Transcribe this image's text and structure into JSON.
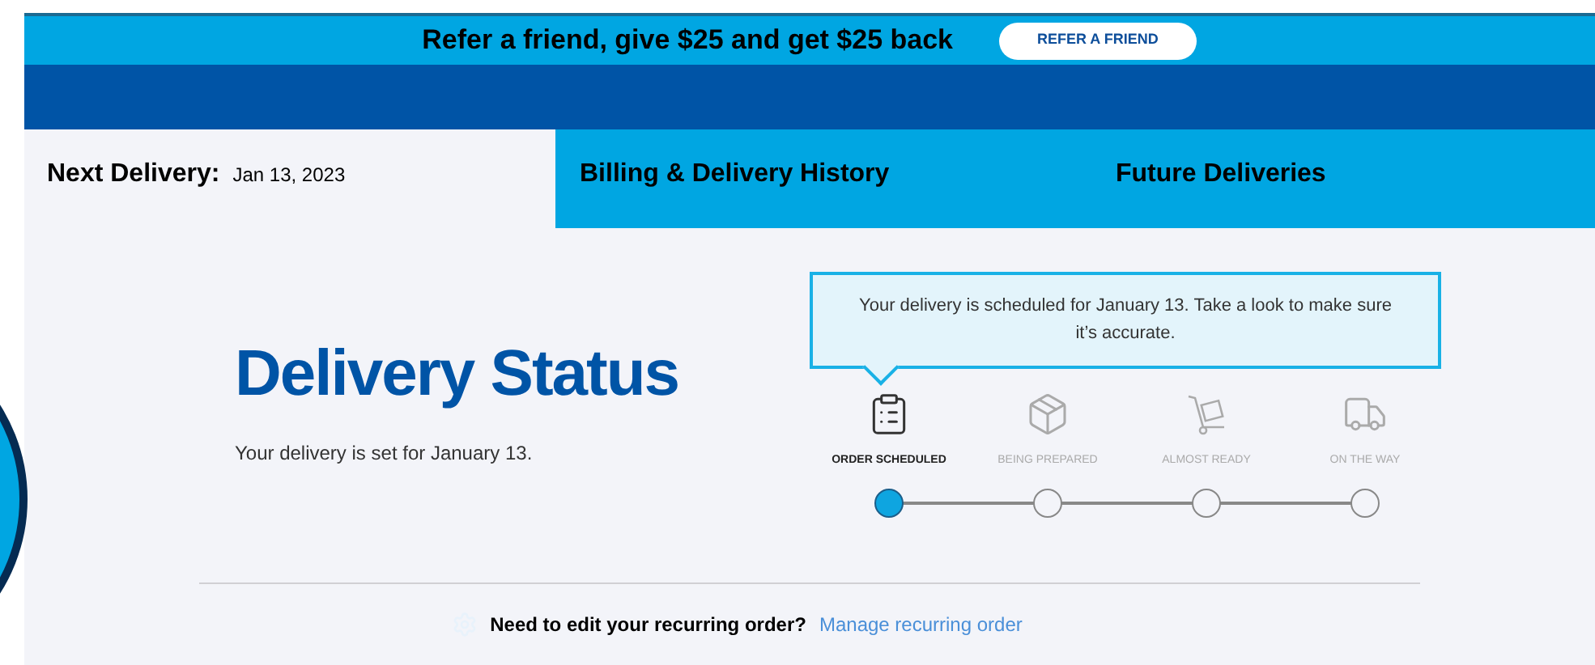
{
  "promo_banner": {
    "text": "Refer a friend, give $25 and get $25 back",
    "button": "REFER A FRIEND"
  },
  "tabs": [
    {
      "label": "Next Delivery:",
      "value": "Jan 13, 2023",
      "selected": true
    },
    {
      "label": "Billing & Delivery History",
      "selected": false
    },
    {
      "label": "Future Deliveries",
      "selected": false
    }
  ],
  "heading": "Delivery Status",
  "subtitle": "Your delivery is set for January 13.",
  "tooltip": "Your delivery is scheduled for January 13. Take a look to make sure it’s accurate.",
  "steps": [
    {
      "kind": "clipboard",
      "label": "ORDER SCHEDULED",
      "selected": true
    },
    {
      "kind": "boxes",
      "label": "BEING PREPARED",
      "selected": false
    },
    {
      "kind": "dolly",
      "label": "ALMOST READY",
      "selected": false
    },
    {
      "kind": "truck",
      "label": "ON THE WAY",
      "selected": false
    }
  ],
  "footer": {
    "question": "Need to edit your recurring order?",
    "link": "Manage recurring order"
  }
}
